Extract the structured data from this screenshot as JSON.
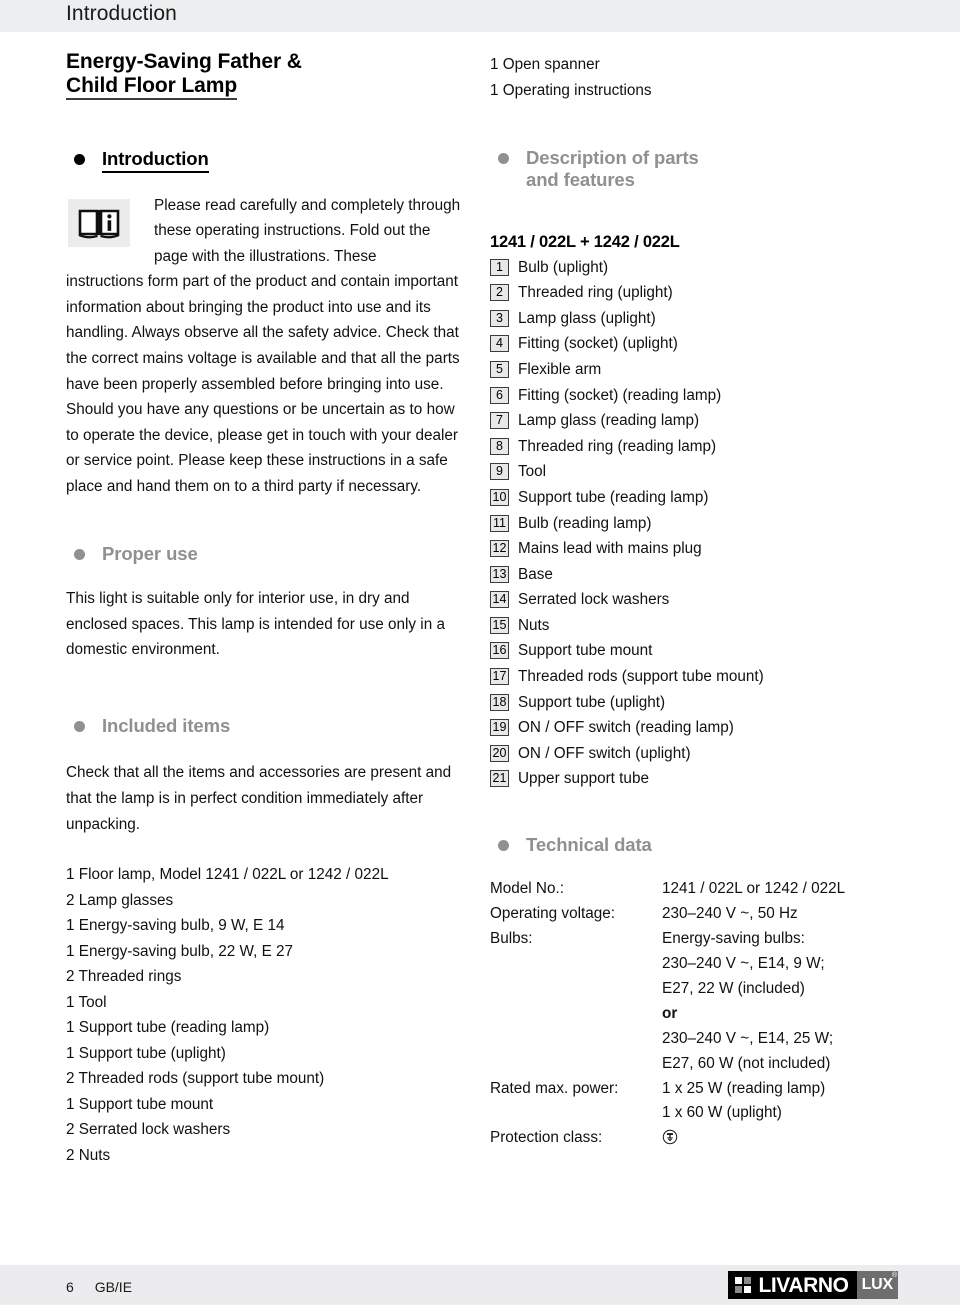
{
  "header": {
    "running_title": "Introduction"
  },
  "product_title": {
    "line1": "Energy-Saving Father &",
    "line2": "Child Floor Lamp"
  },
  "left_column": {
    "intro": {
      "heading": "Introduction",
      "icon": "book-info-icon",
      "indented_text": "Please read carefully and completely through these operating instructions. Fold out the page with the illustrations. These",
      "rest_text": "instructions form part of the product and contain important information about bringing the product into use and its handling. Always observe all the safety advice. Check that the correct mains voltage is available and that all the parts have been properly assembled before bringing into use. Should you have any questions or be uncertain as to how to operate the device, please get in touch with your dealer or service point. Please keep these instructions in a safe place and hand them on to a third party if necessary."
    },
    "proper_use": {
      "heading": "Proper use",
      "body": "This light is suitable only for interior use, in dry and enclosed spaces. This lamp is intended for use only in a domestic environment."
    },
    "included_items": {
      "heading": "Included items",
      "body": "Check that all the items and accessories are present and that the lamp is in perfect condition immediately after unpacking.",
      "items": [
        "1 Floor lamp, Model 1241 / 022L or 1242 / 022L",
        "2 Lamp glasses",
        "1 Energy-saving bulb, 9 W, E 14",
        "1 Energy-saving bulb, 22 W, E 27",
        "2 Threaded rings",
        "1 Tool",
        "1 Support tube (reading lamp)",
        "1 Support tube (uplight)",
        "2 Threaded rods (support tube mount)",
        "1 Support tube mount",
        "2 Serrated lock washers",
        "2 Nuts"
      ]
    }
  },
  "right_column": {
    "top_items": [
      "1 Open spanner",
      "1 Operating instructions"
    ],
    "description": {
      "heading_line1": "Description of parts",
      "heading_line2": "and features",
      "model_line": "1241 / 022L + 1242 / 022L",
      "parts": [
        {
          "num": "1",
          "label": "Bulb (uplight)"
        },
        {
          "num": "2",
          "label": "Threaded ring (uplight)"
        },
        {
          "num": "3",
          "label": "Lamp glass (uplight)"
        },
        {
          "num": "4",
          "label": "Fitting (socket) (uplight)"
        },
        {
          "num": "5",
          "label": "Flexible arm"
        },
        {
          "num": "6",
          "label": "Fitting (socket) (reading lamp)"
        },
        {
          "num": "7",
          "label": "Lamp glass (reading lamp)"
        },
        {
          "num": "8",
          "label": "Threaded ring (reading lamp)"
        },
        {
          "num": "9",
          "label": "Tool"
        },
        {
          "num": "10",
          "label": "Support tube (reading lamp)"
        },
        {
          "num": "11",
          "label": "Bulb (reading lamp)"
        },
        {
          "num": "12",
          "label": "Mains lead with mains plug"
        },
        {
          "num": "13",
          "label": "Base"
        },
        {
          "num": "14",
          "label": "Serrated lock washers"
        },
        {
          "num": "15",
          "label": "Nuts"
        },
        {
          "num": "16",
          "label": "Support tube mount"
        },
        {
          "num": "17",
          "label": "Threaded rods (support tube mount)"
        },
        {
          "num": "18",
          "label": "Support tube (uplight)"
        },
        {
          "num": "19",
          "label": "ON / OFF switch (reading lamp)"
        },
        {
          "num": "20",
          "label": "ON / OFF switch (uplight)"
        },
        {
          "num": "21",
          "label": "Upper support tube"
        }
      ]
    },
    "technical_data": {
      "heading": "Technical data",
      "rows": [
        {
          "key": "Model No.:",
          "value": "1241 / 022L or 1242 / 022L"
        },
        {
          "key": "Operating voltage:",
          "value": "230–240 V ~, 50 Hz"
        },
        {
          "key": "Bulbs:",
          "value": "Energy-saving bulbs:"
        },
        {
          "key": "",
          "value": "230–240 V ~, E14, 9 W;"
        },
        {
          "key": "",
          "value": "E27, 22 W (included)"
        },
        {
          "key": "",
          "value": "or",
          "bold": true
        },
        {
          "key": "",
          "value": "230–240 V ~, E14, 25 W;"
        },
        {
          "key": "",
          "value": "E27, 60 W (not included)"
        },
        {
          "key": "Rated max. power:",
          "value": "1 x 25 W (reading lamp)"
        },
        {
          "key": "",
          "value": "1 x 60 W (uplight)"
        },
        {
          "key": "Protection class:",
          "value": "",
          "symbol": "protective-earth-icon"
        }
      ]
    }
  },
  "footer": {
    "page_number": "6",
    "locale": "GB/IE",
    "logo_word": "LIVARNO",
    "logo_sub": "LUX",
    "logo_reg": "®"
  },
  "colors": {
    "band": "#eceeef",
    "heading_gray": "#8e9092",
    "text": "#111111",
    "num_box_fill": "#e8e8e8",
    "num_box_border": "#3b3b3b",
    "logo_black": "#000000",
    "logo_gray": "#6e6e6e"
  }
}
